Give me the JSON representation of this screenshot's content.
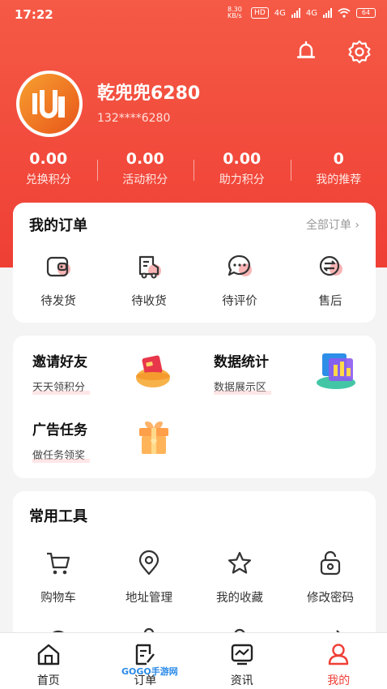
{
  "status_bar": {
    "time": "17:22",
    "speed": "8.30 KB/s",
    "hd": "HD",
    "net1": "4G",
    "net2": "4G",
    "battery": "64"
  },
  "profile": {
    "nickname": "乾兜兜6280",
    "phone": "132****6280"
  },
  "stats": [
    {
      "value": "0.00",
      "label": "兑换积分"
    },
    {
      "value": "0.00",
      "label": "活动积分"
    },
    {
      "value": "0.00",
      "label": "助力积分"
    },
    {
      "value": "0",
      "label": "我的推荐"
    }
  ],
  "orders": {
    "title": "我的订单",
    "all_label": "全部订单",
    "items": [
      {
        "label": "待发货",
        "icon": "wallet-icon"
      },
      {
        "label": "待收货",
        "icon": "delivery-icon"
      },
      {
        "label": "待评价",
        "icon": "comment-icon"
      },
      {
        "label": "售后",
        "icon": "refund-icon"
      }
    ]
  },
  "features": [
    {
      "title": "邀请好友",
      "subtitle": "天天领积分",
      "icon": "red-envelope-icon"
    },
    {
      "title": "数据统计",
      "subtitle": "数据展示区",
      "icon": "data-screen-icon"
    },
    {
      "title": "广告任务",
      "subtitle": "做任务领奖",
      "icon": "gift-box-icon"
    }
  ],
  "tools": {
    "title": "常用工具",
    "items": [
      {
        "label": "购物车",
        "icon": "cart-icon"
      },
      {
        "label": "地址管理",
        "icon": "location-icon"
      },
      {
        "label": "我的收藏",
        "icon": "star-icon"
      },
      {
        "label": "修改密码",
        "icon": "lock-icon"
      }
    ]
  },
  "tabbar": [
    {
      "label": "首页",
      "icon": "home-icon"
    },
    {
      "label": "订单",
      "icon": "order-icon"
    },
    {
      "label": "资讯",
      "icon": "news-icon"
    },
    {
      "label": "我的",
      "icon": "user-icon"
    }
  ],
  "watermark": "GOGO手游网",
  "colors": {
    "primary": "#ef3f35",
    "accent_pink": "#f8b4b4"
  }
}
